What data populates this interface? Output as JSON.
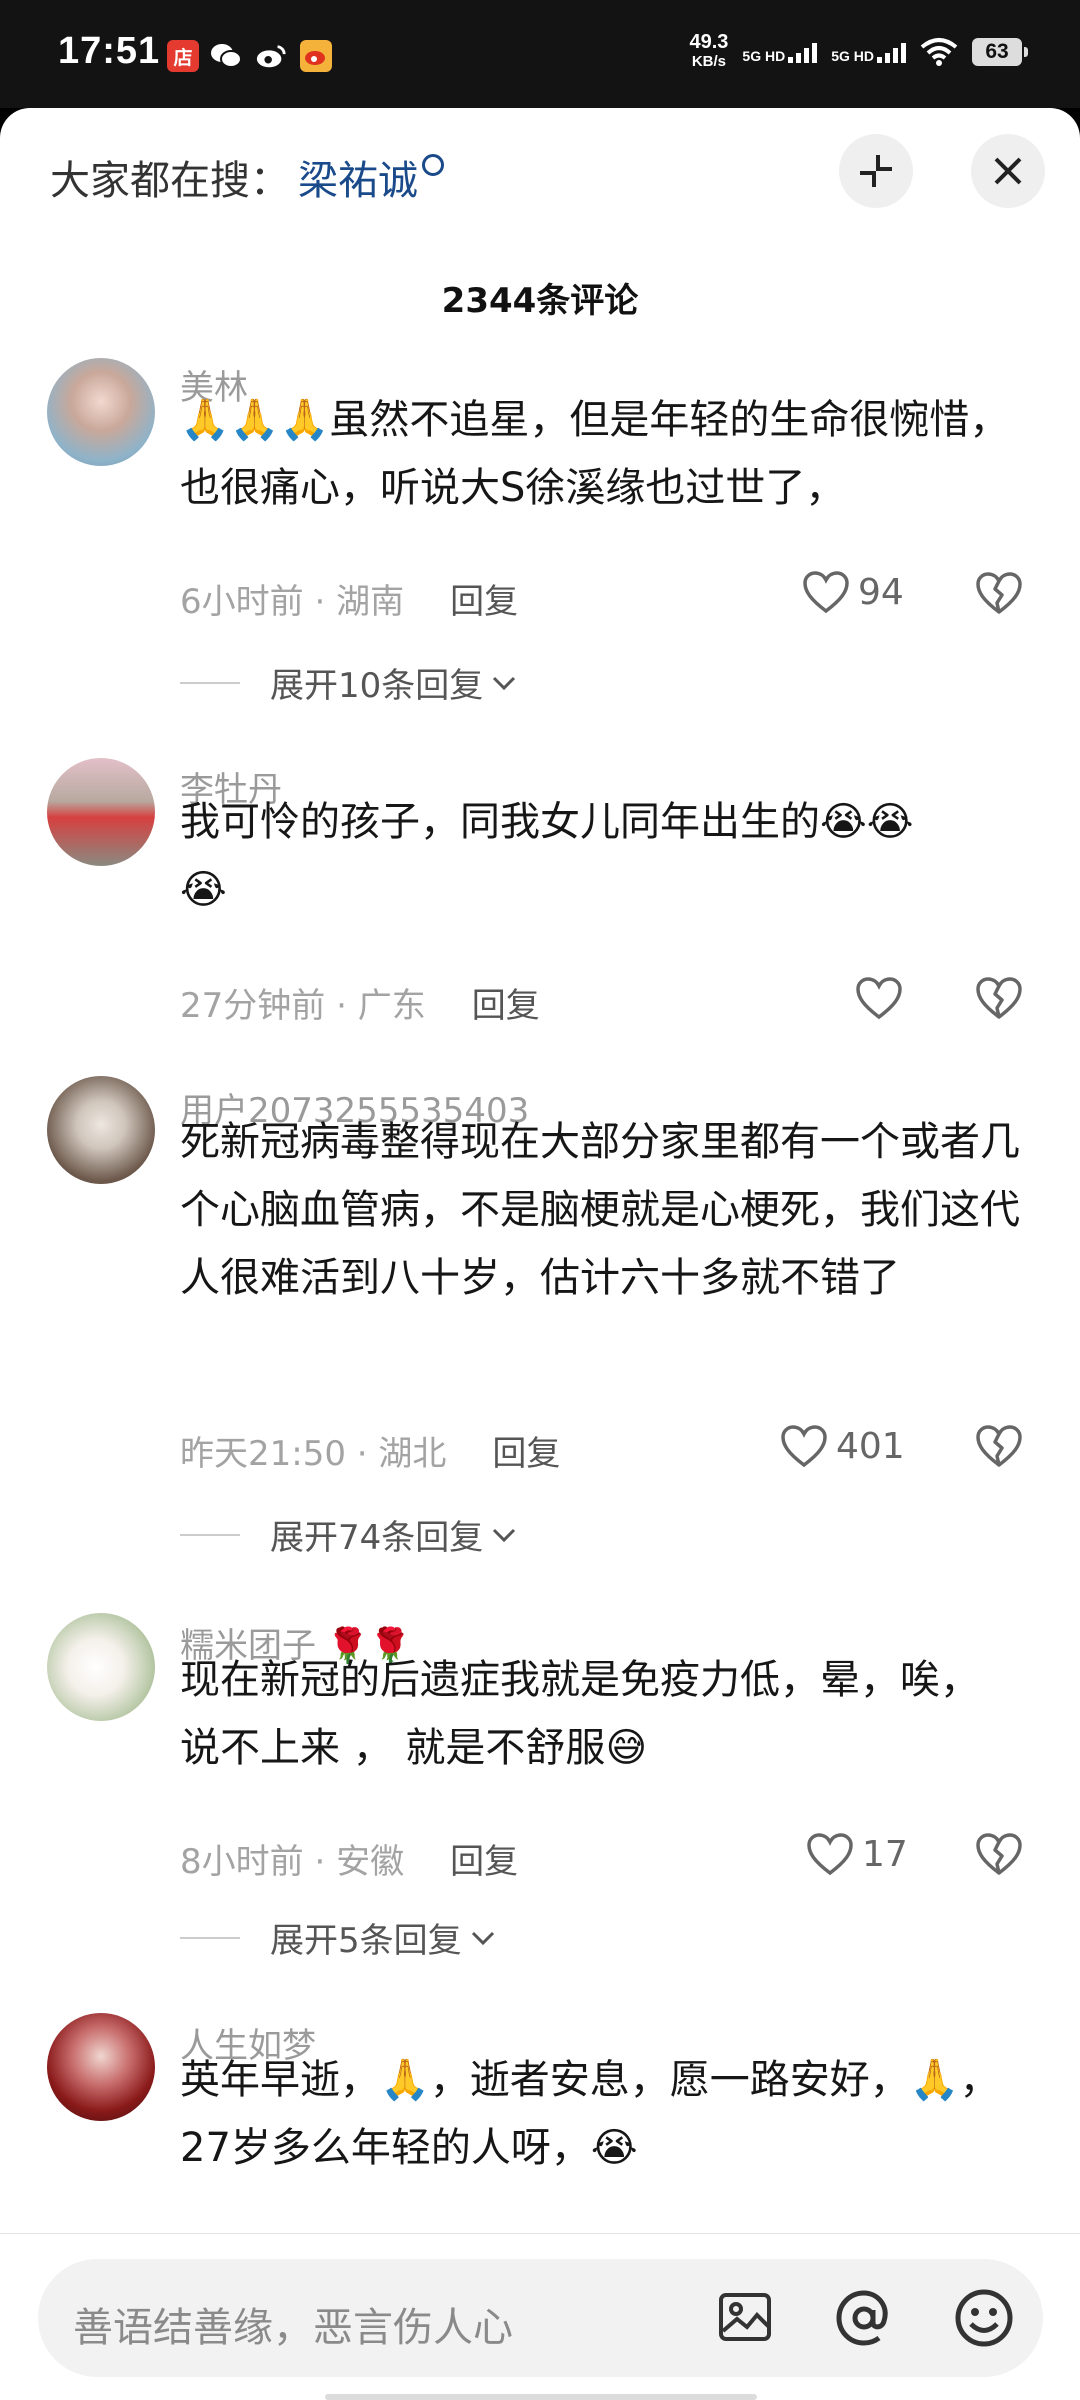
{
  "status_bar": {
    "time": "17:51",
    "speed_value": "49.3",
    "speed_unit": "KB/s",
    "net1": "5G HD",
    "net2": "5G HD",
    "battery": "63",
    "app_icons": [
      "store-icon",
      "wechat-icon",
      "weibo-icon",
      "weibo-app-icon"
    ]
  },
  "search_hint": {
    "prefix": "大家都在搜：",
    "keyword": "梁祐诚"
  },
  "comment_count": "2344条评论",
  "comments": [
    {
      "user": "美林",
      "text": "虽然不追星，但是年轻的生命很惋惜，也很痛心，听说大S徐溪缘也过世了，",
      "time": "6小时前",
      "location": "湖南",
      "reply": "回复",
      "likes": "94",
      "expand": "展开10条回复"
    },
    {
      "user": "李牡丹",
      "text": "我可怜的孩子，同我女儿同年出生的",
      "time": "27分钟前",
      "location": "广东",
      "reply": "回复",
      "likes": ""
    },
    {
      "user": "用户2073255535403",
      "text": "死新冠病毒整得现在大部分家里都有一个或者几个心脑血管病，不是脑梗就是心梗死，我们这代人很难活到八十岁，估计六十多就不错了",
      "time": "昨天21:50",
      "location": "湖北",
      "reply": "回复",
      "likes": "401",
      "expand": "展开74条回复"
    },
    {
      "user": "糯米团子",
      "text1": "现在新冠的后遗症我就是免疫力低，晕，唉，",
      "text2": "说不上来 ， 就是不舒服",
      "time": "8小时前",
      "location": "安徽",
      "reply": "回复",
      "likes": "17",
      "expand": "展开5条回复"
    },
    {
      "user": "人生如梦",
      "part1": "英年早逝，",
      "part2": "，逝者安息，愿一路安好，",
      "part3": "，",
      "line2": "27岁多么年轻的人呀，"
    }
  ],
  "input": {
    "placeholder": "善语结善缘，恶言伤人心"
  },
  "colors": {
    "link": "#1a4a8a",
    "meta": "#a3a3a3",
    "text": "#161616"
  }
}
